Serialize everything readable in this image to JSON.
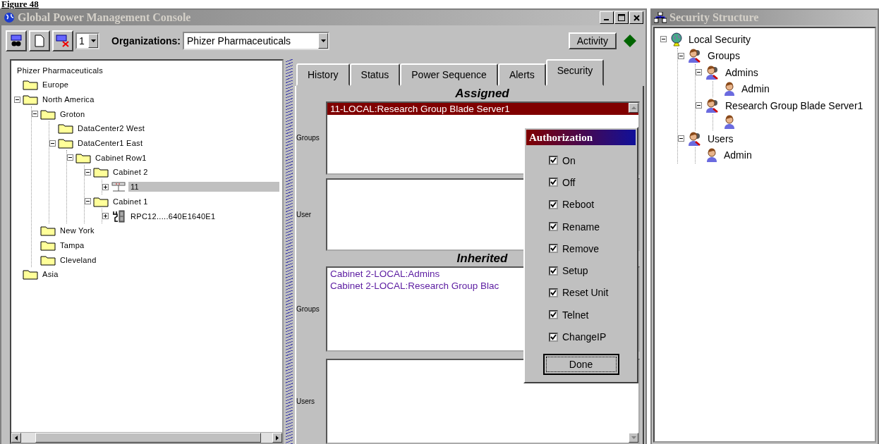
{
  "figure_label": "Figure 48",
  "main_window": {
    "title": "Global Power Management Console",
    "toolbar": {
      "page_spinner": "1",
      "organizations_label": "Organizations:",
      "organization": "Phizer Pharmaceuticals",
      "activity_button": "Activity"
    },
    "tree": {
      "root": "Phizer Pharmaceuticals",
      "items": [
        {
          "label": "Europe",
          "kind": "folder",
          "selected": false
        },
        {
          "label": "North America",
          "kind": "folder",
          "selected": false,
          "expanded": true,
          "children": [
            {
              "label": "Groton",
              "kind": "folder",
              "selected": false,
              "expanded": true,
              "children": [
                {
                  "label": "DataCenter2 West",
                  "kind": "folder",
                  "selected": false
                },
                {
                  "label": "DataCenter1 East",
                  "kind": "folder",
                  "selected": false,
                  "expanded": true,
                  "children": [
                    {
                      "label": "Cabinet Row1",
                      "kind": "folder",
                      "selected": false,
                      "expanded": true,
                      "children": [
                        {
                          "label": "Cabinet 2",
                          "kind": "folder",
                          "selected": false,
                          "expanded": true,
                          "children": [
                            {
                              "label": "11",
                              "kind": "device",
                              "selected": true,
                              "expanded": false
                            }
                          ]
                        },
                        {
                          "label": "Cabinet 1",
                          "kind": "folder",
                          "selected": false,
                          "expanded": true,
                          "children": [
                            {
                              "label": "RPC12.....640E1640E1",
                              "kind": "power",
                              "selected": false,
                              "expanded": false
                            }
                          ]
                        }
                      ]
                    }
                  ]
                }
              ]
            },
            {
              "label": "New York",
              "kind": "folder",
              "selected": false
            },
            {
              "label": "Tampa",
              "kind": "folder",
              "selected": false
            },
            {
              "label": "Cleveland",
              "kind": "folder",
              "selected": false
            }
          ]
        },
        {
          "label": "Asia",
          "kind": "folder",
          "selected": false
        }
      ]
    },
    "tabs": [
      {
        "label": "History",
        "selected": false
      },
      {
        "label": "Status",
        "selected": false
      },
      {
        "label": "Power Sequence",
        "selected": false
      },
      {
        "label": "Alerts",
        "selected": false
      },
      {
        "label": "Security",
        "selected": true
      }
    ],
    "security": {
      "assigned_heading": "Assigned",
      "assigned_groups_label": "Groups",
      "assigned_groups": [
        {
          "text": "11-LOCAL:Research Group Blade Server1",
          "selected": true
        }
      ],
      "assigned_users_label": "User",
      "inherited_heading": "Inherited",
      "inherited_groups_label": "Groups",
      "inherited_groups": [
        {
          "text": "Cabinet 2-LOCAL:Admins",
          "selected": false
        },
        {
          "text": "Cabinet 2-LOCAL:Research Group Blac",
          "selected": false
        }
      ],
      "inherited_users_label": "Users"
    },
    "authorization": {
      "title": "Authorization",
      "options": [
        {
          "label": "On",
          "checked": true
        },
        {
          "label": "Off",
          "checked": true
        },
        {
          "label": "Reboot",
          "checked": true
        },
        {
          "label": "Rename",
          "checked": true
        },
        {
          "label": "Remove",
          "checked": true
        },
        {
          "label": "Setup",
          "checked": true
        },
        {
          "label": "Reset Unit",
          "checked": true
        },
        {
          "label": "Telnet",
          "checked": true
        },
        {
          "label": "ChangeIP",
          "checked": true
        }
      ],
      "done_button": "Done"
    }
  },
  "security_window": {
    "title": "Security Structure",
    "tree": [
      {
        "label": "Local Security",
        "kind": "globe",
        "expanded": true,
        "children": [
          {
            "label": "Groups",
            "kind": "group",
            "expanded": true,
            "children": [
              {
                "label": "Admins",
                "kind": "group",
                "expanded": true,
                "children": [
                  {
                    "label": "Admin",
                    "kind": "user"
                  }
                ]
              },
              {
                "label": "Research Group Blade Server1",
                "kind": "group",
                "expanded": true,
                "children": [
                  {
                    "kind": "user"
                  }
                ]
              }
            ]
          },
          {
            "label": "Users",
            "kind": "group",
            "expanded": true,
            "children": [
              {
                "label": "Admin",
                "kind": "user"
              }
            ]
          }
        ]
      }
    ]
  }
}
